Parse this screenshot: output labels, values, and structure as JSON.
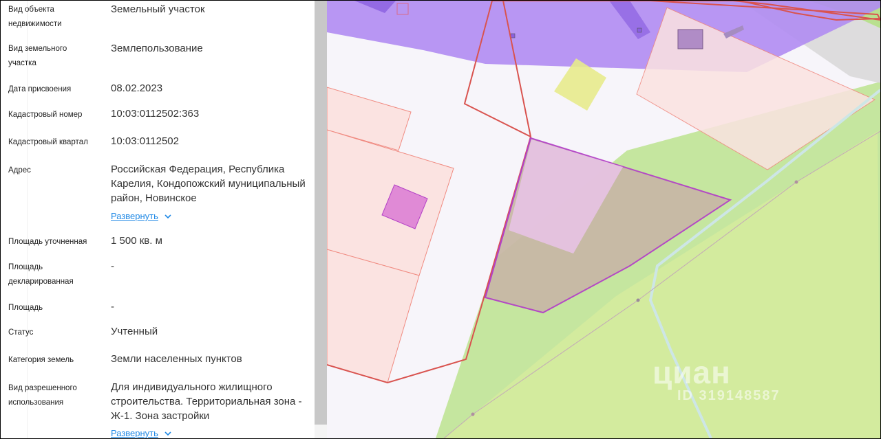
{
  "panel": {
    "rows": [
      {
        "label": "Вид объекта\nнедвижимости",
        "value": "Земельный участок"
      },
      {
        "label": "Вид земельного\nучастка",
        "value": "Землепользование"
      },
      {
        "label": "Дата присвоения",
        "value": "08.02.2023"
      },
      {
        "label": "Кадастровый номер",
        "value": "10:03:0112502:363"
      },
      {
        "label": "Кадастровый квартал",
        "value": "10:03:0112502"
      },
      {
        "label": "Адрес",
        "value": "Российская Федерация, Республика Карелия, Кондопожский муниципальный район, Новинское",
        "expand": "Развернуть"
      },
      {
        "label": "Площадь уточненная",
        "value": "1 500 кв. м"
      },
      {
        "label": "Площадь\nдекларированная",
        "value": "-"
      },
      {
        "label": "Площадь",
        "value": "-"
      },
      {
        "label": "Статус",
        "value": "Учтенный"
      },
      {
        "label": "Категория земель",
        "value": "Земли населенных пунктов"
      },
      {
        "label": "Вид разрешенного\nиспользования",
        "value": "Для индивидуального жилищного строительства. Территориальная зона - Ж-1. Зона застройки",
        "expand": "Развернуть"
      }
    ]
  },
  "map": {
    "watermark_brand": "циан",
    "watermark_id": "ID 319148587",
    "colors": {
      "background": "#f7f5fa",
      "parcel_fill": "#fbe3e1",
      "parcel_stroke": "#f08a80",
      "boundary_red": "#d9534f",
      "purple_zone": "#b08cf2",
      "green_zone": "#c2e59a",
      "selected_stroke": "#b341c6",
      "selected_fill": "#c8b8a6"
    }
  }
}
